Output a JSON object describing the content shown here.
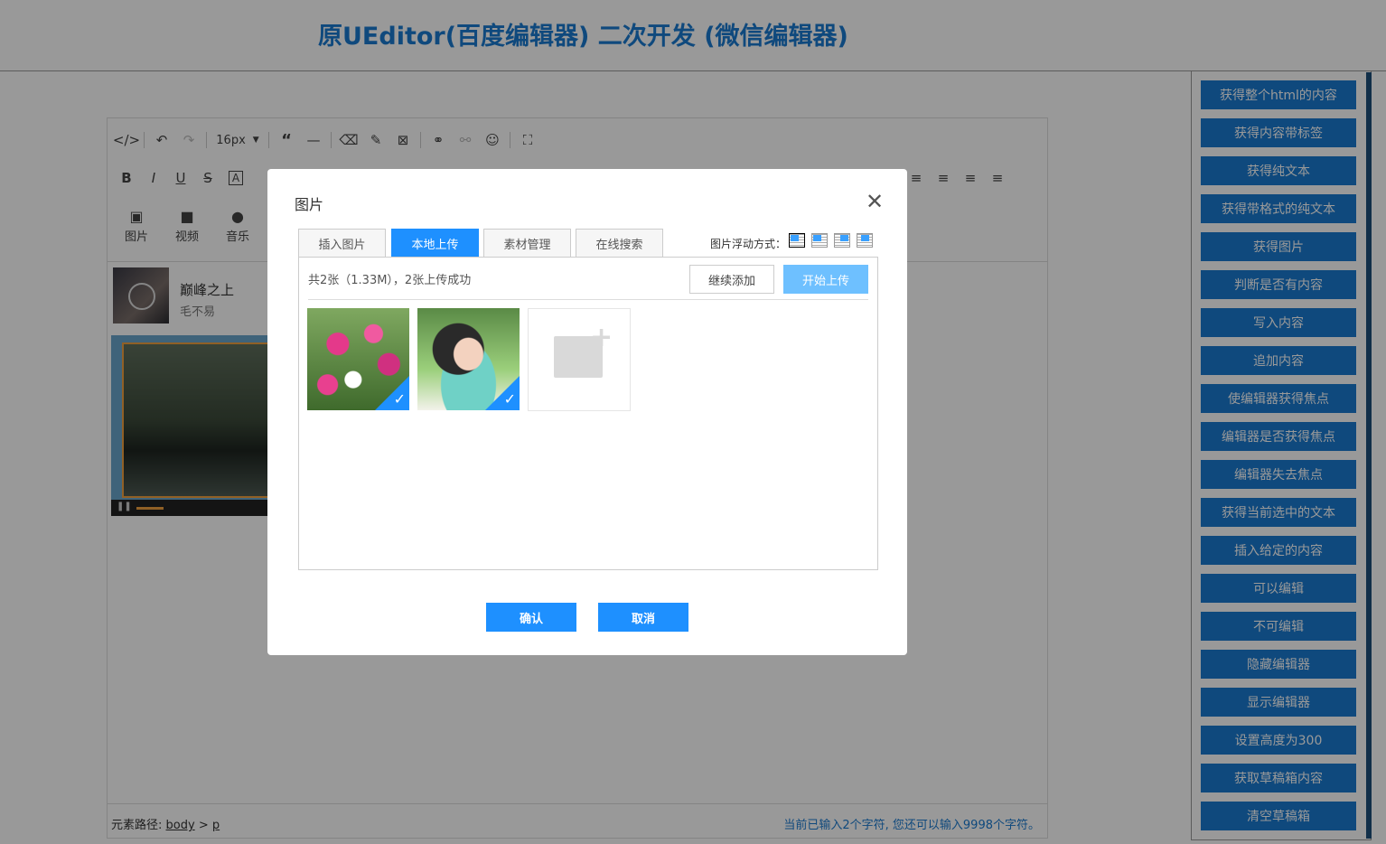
{
  "header": {
    "title": "原UEditor(百度编辑器) 二次开发 (微信编辑器)"
  },
  "toolbar": {
    "font_size": "16px",
    "row2_labels": [
      "B",
      "I",
      "U",
      "S",
      "A"
    ],
    "media": [
      {
        "icon": "image-icon",
        "label": "图片"
      },
      {
        "icon": "video-icon",
        "label": "视频"
      },
      {
        "icon": "microphone-icon",
        "label": "音乐"
      }
    ]
  },
  "content": {
    "song_title": "巅峰之上",
    "song_artist": "毛不易"
  },
  "status": {
    "path_label": "元素路径:",
    "path_body": "body",
    "path_sep": ">",
    "path_p": "p",
    "count_text": "当前已输入2个字符, 您还可以输入9998个字符。"
  },
  "sidebar": {
    "buttons": [
      "获得整个html的内容",
      "获得内容带标签",
      "获得纯文本",
      "获得带格式的纯文本",
      "获得图片",
      "判断是否有内容",
      "写入内容",
      "追加内容",
      "使编辑器获得焦点",
      "编辑器是否获得焦点",
      "编辑器失去焦点",
      "获得当前选中的文本",
      "插入给定的内容",
      "可以编辑",
      "不可编辑",
      "隐藏编辑器",
      "显示编辑器",
      "设置高度为300",
      "获取草稿箱内容",
      "清空草稿箱"
    ]
  },
  "dialog": {
    "title": "图片",
    "tabs": [
      "插入图片",
      "本地上传",
      "素材管理",
      "在线搜索"
    ],
    "active_tab": 1,
    "float_label": "图片浮动方式：",
    "upload_info": "共2张（1.33M），2张上传成功",
    "continue_label": "继续添加",
    "start_label": "开始上传",
    "ok_label": "确认",
    "cancel_label": "取消"
  },
  "colors": {
    "accent": "#1a7ad0",
    "dialog_primary": "#1e90ff",
    "start_button": "#6ec0ff"
  }
}
